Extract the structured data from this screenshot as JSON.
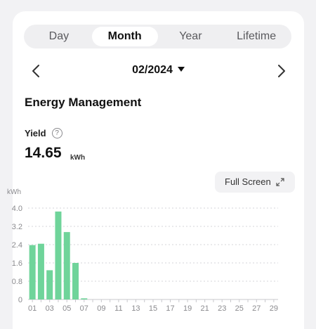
{
  "tabs": [
    {
      "label": "Day",
      "active": false
    },
    {
      "label": "Month",
      "active": true
    },
    {
      "label": "Year",
      "active": false
    },
    {
      "label": "Lifetime",
      "active": false
    }
  ],
  "date_nav": {
    "value": "02/2024",
    "prev_icon": "chevron-left-icon",
    "next_icon": "chevron-right-icon"
  },
  "section_title": "Energy Management",
  "yield": {
    "label": "Yield",
    "help_icon": "?",
    "value": "14.65",
    "unit": "kWh"
  },
  "full_screen_label": "Full Screen",
  "colors": {
    "bar": "#6fd49a",
    "grid": "#d6d6da",
    "axis_text": "#8a8a8e"
  },
  "chart_data": {
    "type": "bar",
    "ylabel": "kWh",
    "ylim": [
      0,
      4.0
    ],
    "yticks": [
      "4.0",
      "3.2",
      "2.4",
      "1.6",
      "0.8",
      "0"
    ],
    "xtick_labels": [
      "01",
      "03",
      "05",
      "07",
      "09",
      "11",
      "13",
      "15",
      "17",
      "19",
      "21",
      "23",
      "25",
      "27",
      "29"
    ],
    "categories": [
      "01",
      "02",
      "03",
      "04",
      "05",
      "06",
      "07",
      "08",
      "09",
      "10",
      "11",
      "12",
      "13",
      "14",
      "15",
      "16",
      "17",
      "18",
      "19",
      "20",
      "21",
      "22",
      "23",
      "24",
      "25",
      "26",
      "27",
      "28",
      "29"
    ],
    "values": [
      2.38,
      2.44,
      1.28,
      3.85,
      2.95,
      1.6,
      0.05,
      0,
      0,
      0,
      0,
      0,
      0,
      0,
      0,
      0,
      0,
      0,
      0,
      0,
      0,
      0,
      0,
      0,
      0,
      0,
      0,
      0,
      0
    ],
    "grid": true
  }
}
